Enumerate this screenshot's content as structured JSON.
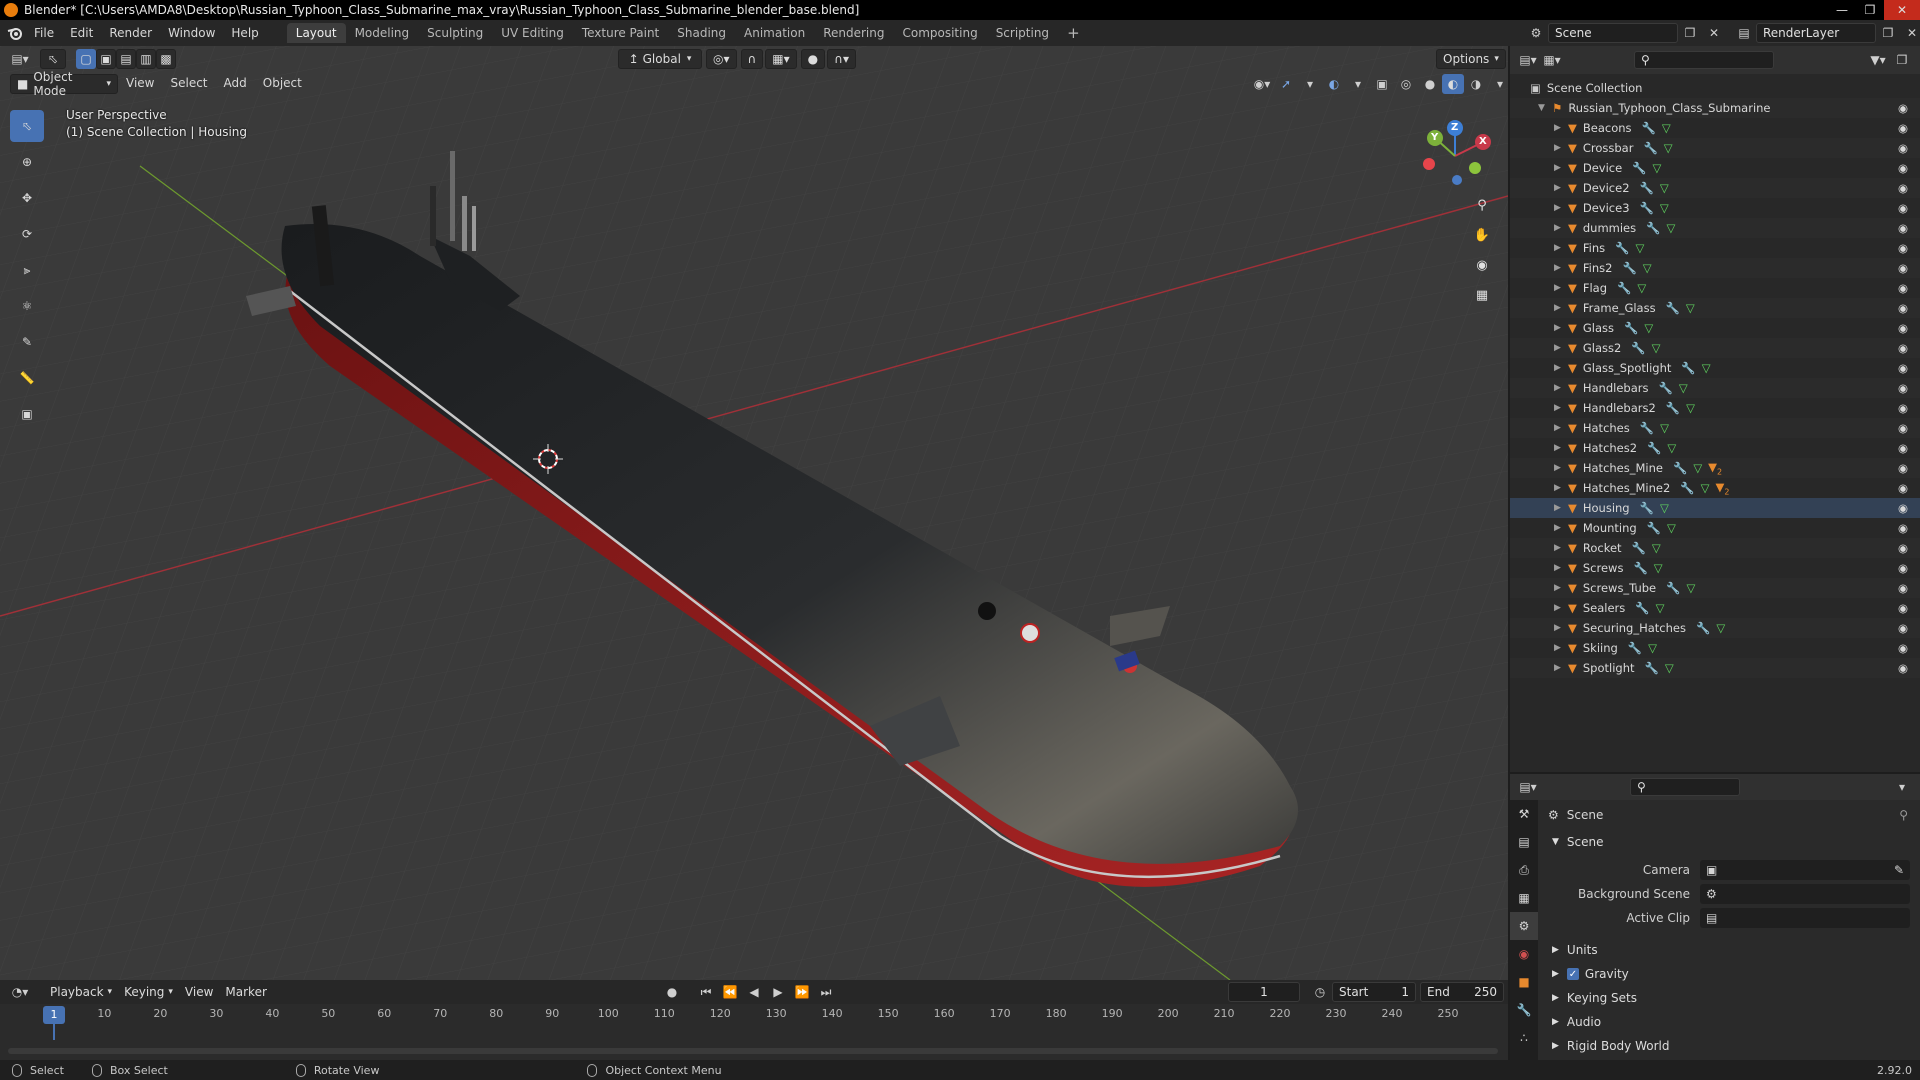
{
  "titlebar": {
    "title": "Blender* [C:\\Users\\AMDA8\\Desktop\\Russian_Typhoon_Class_Submarine_max_vray\\Russian_Typhoon_Class_Submarine_blender_base.blend]"
  },
  "menu": [
    "File",
    "Edit",
    "Render",
    "Window",
    "Help"
  ],
  "workspaces": [
    "Layout",
    "Modeling",
    "Sculpting",
    "UV Editing",
    "Texture Paint",
    "Shading",
    "Animation",
    "Rendering",
    "Compositing",
    "Scripting"
  ],
  "active_workspace": "Layout",
  "scene_field": "Scene",
  "renderlayer_field": "RenderLayer",
  "viewport": {
    "mode": "Object Mode",
    "menus": [
      "View",
      "Select",
      "Add",
      "Object"
    ],
    "transform_orientation": "Global",
    "options_label": "Options",
    "overlay_title": "User Perspective",
    "overlay_subtitle": "(1) Scene Collection | Housing",
    "gizmo_axes": {
      "z": "Z",
      "y": "Y",
      "x": "X"
    }
  },
  "outliner": {
    "root": "Scene Collection",
    "collection": "Russian_Typhoon_Class_Submarine",
    "objects": [
      {
        "name": "Beacons",
        "extra": false
      },
      {
        "name": "Crossbar",
        "extra": false
      },
      {
        "name": "Device",
        "extra": false
      },
      {
        "name": "Device2",
        "extra": false
      },
      {
        "name": "Device3",
        "extra": false
      },
      {
        "name": "dummies",
        "extra": false
      },
      {
        "name": "Fins",
        "extra": false
      },
      {
        "name": "Fins2",
        "extra": false
      },
      {
        "name": "Flag",
        "extra": false
      },
      {
        "name": "Frame_Glass",
        "extra": false
      },
      {
        "name": "Glass",
        "extra": false
      },
      {
        "name": "Glass2",
        "extra": false
      },
      {
        "name": "Glass_Spotlight",
        "extra": false
      },
      {
        "name": "Handlebars",
        "extra": false
      },
      {
        "name": "Handlebars2",
        "extra": false
      },
      {
        "name": "Hatches",
        "extra": false
      },
      {
        "name": "Hatches2",
        "extra": false
      },
      {
        "name": "Hatches_Mine",
        "extra": true
      },
      {
        "name": "Hatches_Mine2",
        "extra": true
      },
      {
        "name": "Housing",
        "extra": false
      },
      {
        "name": "Mounting",
        "extra": false
      },
      {
        "name": "Rocket",
        "extra": false
      },
      {
        "name": "Screws",
        "extra": false
      },
      {
        "name": "Screws_Tube",
        "extra": false
      },
      {
        "name": "Sealers",
        "extra": false
      },
      {
        "name": "Securing_Hatches",
        "extra": false
      },
      {
        "name": "Skiing",
        "extra": false
      },
      {
        "name": "Spotlight",
        "extra": false
      }
    ],
    "extra_badge": "2"
  },
  "properties": {
    "context_title": "Scene",
    "panel_scene": "Scene",
    "camera_label": "Camera",
    "background_scene_label": "Background Scene",
    "active_clip_label": "Active Clip",
    "panels": [
      "Units",
      "Gravity",
      "Keying Sets",
      "Audio",
      "Rigid Body World"
    ]
  },
  "timeline": {
    "menus": [
      "Playback",
      "Keying",
      "View",
      "Marker"
    ],
    "current_frame": "1",
    "start_label": "Start",
    "start_value": "1",
    "end_label": "End",
    "end_value": "250",
    "ticks": [
      1,
      10,
      20,
      30,
      40,
      50,
      60,
      70,
      80,
      90,
      100,
      110,
      120,
      130,
      140,
      150,
      160,
      170,
      180,
      190,
      200,
      210,
      220,
      230,
      240,
      250
    ]
  },
  "status": {
    "select": "Select",
    "box_select": "Box Select",
    "rotate_view": "Rotate View",
    "context_menu": "Object Context Menu",
    "version": "2.92.0"
  },
  "colors": {
    "accent": "#4772b3",
    "mesh_icon": "#e88a2e",
    "mod_icon": "#6fa8dc",
    "data_icon": "#5fd35f",
    "x_axis": "#c8394a",
    "y_axis": "#7db13a"
  }
}
